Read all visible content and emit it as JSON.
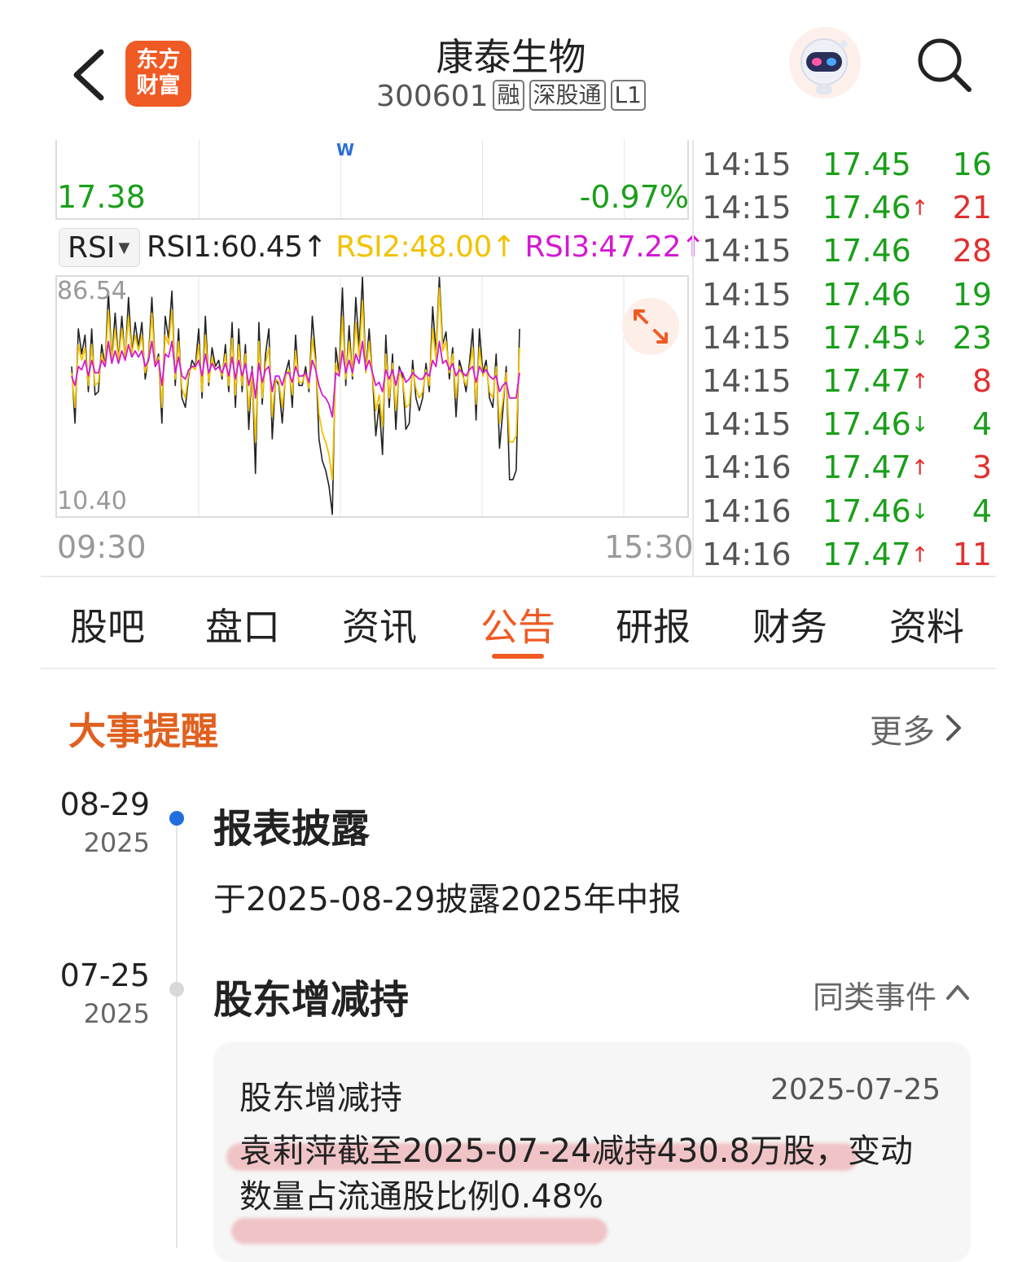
{
  "header": {
    "app_logo_line1": "东方",
    "app_logo_line2": "财富",
    "stock_name": "康泰生物",
    "stock_code": "300601",
    "tags": [
      "融",
      "深股通",
      "L1"
    ]
  },
  "chart": {
    "price": "17.38",
    "change_pct": "-0.97%",
    "marker": "W",
    "indicator": "RSI",
    "rsi1": "RSI1:60.45",
    "rsi2": "RSI2:48.00",
    "rsi3": "RSI3:47.22",
    "arrow": "↑",
    "rsi_max": "86.54",
    "rsi_min": "10.40",
    "time_start": "09:30",
    "time_end": "15:30",
    "colors": {
      "rsi1": "#222222",
      "rsi2": "#f2c200",
      "rsi3": "#d21ad2"
    }
  },
  "chart_data": {
    "type": "line",
    "x_range": [
      "09:30",
      "15:30"
    ],
    "ylim": [
      10.4,
      86.54
    ],
    "series": [
      {
        "name": "RSI1",
        "values": [
          58,
          40,
          70,
          62,
          68,
          50,
          70,
          49,
          50,
          65,
          58,
          82,
          60,
          75,
          60,
          74,
          60,
          80,
          62,
          72,
          64,
          72,
          54,
          61,
          80,
          58,
          62,
          40,
          74,
          67,
          82,
          52,
          70,
          48,
          45,
          55,
          60,
          58,
          70,
          48,
          74,
          52,
          64,
          58,
          60,
          54,
          65,
          50,
          72,
          45,
          70,
          50,
          65,
          38,
          58,
          24,
          72,
          46,
          62,
          70,
          35,
          54,
          52,
          40,
          56,
          60,
          45,
          68,
          52,
          52,
          58,
          50,
          74,
          61,
          35,
          28,
          25,
          20,
          11,
          64,
          56,
          83,
          52,
          71,
          54,
          80,
          64,
          90,
          56,
          70,
          55,
          36,
          46,
          30,
          68,
          45,
          62,
          38,
          58,
          55,
          38,
          40,
          60,
          48,
          44,
          48,
          59,
          50,
          77,
          62,
          96,
          65,
          69,
          54,
          64,
          42,
          60,
          56,
          50,
          59,
          70,
          41,
          70,
          56,
          60,
          48,
          45,
          62,
          32,
          44,
          58,
          22,
          22,
          25,
          70
        ]
      },
      {
        "name": "RSI2",
        "values": [
          56,
          45,
          65,
          60,
          64,
          52,
          65,
          52,
          53,
          62,
          58,
          76,
          60,
          70,
          60,
          70,
          61,
          74,
          62,
          68,
          63,
          68,
          56,
          60,
          75,
          58,
          61,
          45,
          68,
          65,
          76,
          54,
          66,
          51,
          48,
          56,
          58,
          57,
          65,
          50,
          68,
          53,
          61,
          57,
          58,
          55,
          62,
          52,
          67,
          49,
          65,
          52,
          62,
          44,
          57,
          34,
          66,
          48,
          59,
          64,
          42,
          54,
          53,
          45,
          55,
          57,
          49,
          63,
          53,
          53,
          56,
          51,
          67,
          59,
          43,
          37,
          34,
          30,
          22,
          59,
          55,
          74,
          54,
          66,
          55,
          72,
          61,
          79,
          56,
          66,
          55,
          44,
          49,
          39,
          62,
          48,
          59,
          44,
          56,
          54,
          45,
          46,
          57,
          51,
          48,
          50,
          57,
          52,
          70,
          60,
          83,
          63,
          66,
          56,
          62,
          48,
          58,
          55,
          52,
          57,
          64,
          46,
          64,
          55,
          58,
          50,
          48,
          58,
          40,
          47,
          56,
          34,
          34,
          36,
          64
        ]
      },
      {
        "name": "RSI3",
        "values": [
          55,
          52,
          58,
          57,
          60,
          55,
          60,
          56,
          56,
          60,
          58,
          66,
          59,
          63,
          59,
          63,
          60,
          65,
          61,
          63,
          61,
          63,
          58,
          60,
          66,
          58,
          60,
          52,
          62,
          61,
          66,
          56,
          61,
          55,
          54,
          57,
          58,
          58,
          60,
          55,
          62,
          56,
          59,
          57,
          58,
          56,
          59,
          55,
          61,
          54,
          60,
          55,
          59,
          52,
          57,
          48,
          59,
          53,
          57,
          58,
          50,
          55,
          55,
          52,
          56,
          56,
          53,
          58,
          55,
          55,
          56,
          53,
          60,
          57,
          52,
          49,
          48,
          46,
          42,
          56,
          55,
          63,
          56,
          60,
          56,
          62,
          59,
          66,
          57,
          60,
          56,
          52,
          53,
          50,
          57,
          54,
          57,
          52,
          57,
          56,
          53,
          54,
          56,
          55,
          54,
          54,
          56,
          55,
          60,
          58,
          66,
          59,
          60,
          57,
          59,
          55,
          57,
          56,
          55,
          57,
          58,
          53,
          58,
          56,
          57,
          55,
          54,
          55,
          50,
          52,
          53,
          48,
          48,
          48,
          56
        ]
      }
    ]
  },
  "ticks": [
    {
      "time": "14:15",
      "price": "17.45",
      "arrow": "",
      "vol": "16",
      "dir": "dn"
    },
    {
      "time": "14:15",
      "price": "17.46",
      "arrow": "↑",
      "vol": "21",
      "dir": "up"
    },
    {
      "time": "14:15",
      "price": "17.46",
      "arrow": "",
      "vol": "28",
      "dir": "up"
    },
    {
      "time": "14:15",
      "price": "17.46",
      "arrow": "",
      "vol": "19",
      "dir": "dn"
    },
    {
      "time": "14:15",
      "price": "17.45",
      "arrow": "↓",
      "vol": "23",
      "dir": "dn"
    },
    {
      "time": "14:15",
      "price": "17.47",
      "arrow": "↑",
      "vol": "8",
      "dir": "up"
    },
    {
      "time": "14:15",
      "price": "17.46",
      "arrow": "↓",
      "vol": "4",
      "dir": "dn"
    },
    {
      "time": "14:16",
      "price": "17.47",
      "arrow": "↑",
      "vol": "3",
      "dir": "up"
    },
    {
      "time": "14:16",
      "price": "17.46",
      "arrow": "↓",
      "vol": "4",
      "dir": "dn"
    },
    {
      "time": "14:16",
      "price": "17.47",
      "arrow": "↑",
      "vol": "11",
      "dir": "up"
    }
  ],
  "tabs": [
    "股吧",
    "盘口",
    "资讯",
    "公告",
    "研报",
    "财务",
    "资料"
  ],
  "active_tab": "公告",
  "events": {
    "title": "大事提醒",
    "more": "更多",
    "items": [
      {
        "date_md": "08-29",
        "year": "2025",
        "title": "报表披露",
        "desc": "于2025-08-29披露2025年中报"
      },
      {
        "date_md": "07-25",
        "year": "2025",
        "title": "股东增减持",
        "similar": "同类事件"
      }
    ],
    "card": {
      "title": "股东增减持",
      "date": "2025-07-25",
      "text": "袁莉萍截至2025-07-24减持430.8万股，变动数量占流通股比例0.48%"
    }
  }
}
